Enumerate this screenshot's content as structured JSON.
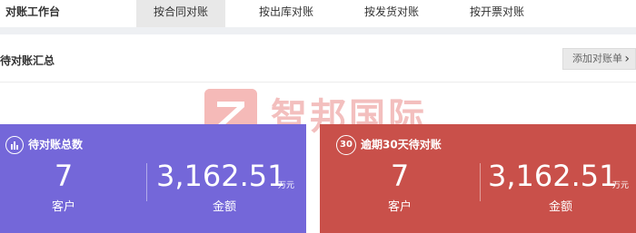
{
  "app": {
    "title": "对账工作台"
  },
  "tabs": [
    {
      "label": "按合同对账",
      "active": true
    },
    {
      "label": "按出库对账",
      "active": false
    },
    {
      "label": "按发货对账",
      "active": false
    },
    {
      "label": "按开票对账",
      "active": false
    }
  ],
  "summary": {
    "title": "待对账汇总",
    "add_button_label": "添加对账单"
  },
  "watermark": {
    "text": "智邦国际"
  },
  "cards": [
    {
      "title": "待对账总数",
      "icon": "bar-chart-icon",
      "color": "#7467d9",
      "customers": "7",
      "customers_label": "客户",
      "amount": "3,162.51",
      "amount_unit": "万元",
      "amount_label": "金额"
    },
    {
      "title": "逾期30天待对账",
      "badge": "30",
      "color": "#c9504a",
      "customers": "7",
      "customers_label": "客户",
      "amount": "3,162.51",
      "amount_unit": "万元",
      "amount_label": "金额"
    }
  ]
}
